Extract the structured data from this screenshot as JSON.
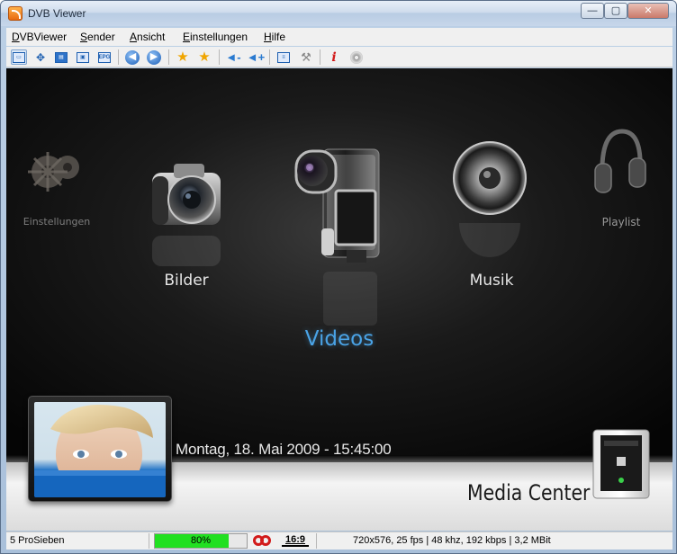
{
  "window": {
    "title": "DVB Viewer",
    "btn_min": "—",
    "btn_max": "▢",
    "btn_close": "✕"
  },
  "menu": [
    {
      "accel": "D",
      "rest": "VBViewer"
    },
    {
      "accel": "S",
      "rest": "ender"
    },
    {
      "accel": "A",
      "rest": "nsicht"
    },
    {
      "accel": "E",
      "rest": "instellungen"
    },
    {
      "accel": "H",
      "rest": "ilfe"
    }
  ],
  "toolbar": {
    "epg_label": "EPG",
    "prev_glyph": "◀",
    "next_glyph": "▶",
    "star_glyph": "★",
    "vol_down": "◄-",
    "vol_up": "◄+",
    "record_glyph": "i",
    "colors": {
      "accent": "#1d5fb0",
      "star": "#f0a500",
      "record": "#d21b1b"
    }
  },
  "media_center": {
    "items": [
      {
        "label": "Einstellungen",
        "icon": "gear-icon",
        "selected": false
      },
      {
        "label": "Bilder",
        "icon": "camera-icon",
        "selected": false
      },
      {
        "label": "Videos",
        "icon": "camcorder-icon",
        "selected": true
      },
      {
        "label": "Musik",
        "icon": "speaker-icon",
        "selected": false
      },
      {
        "label": "Playlist",
        "icon": "headphones-icon",
        "selected": false
      }
    ],
    "datetime": "Montag, 18. Mai 2009 - 15:45:00",
    "brand": "Media Center",
    "colors": {
      "selected": "#4aa3e6",
      "label": "#e6e6e6",
      "dim_label": "#8a8a8a"
    }
  },
  "status": {
    "channel": "5 ProSieben",
    "signal_text": "80%",
    "signal_level": 0.8,
    "signal_color": "#21e021",
    "aspect": "16:9",
    "stream_info": "720x576, 25 fps | 48 khz, 192 kbps | 3,2 MBit"
  }
}
